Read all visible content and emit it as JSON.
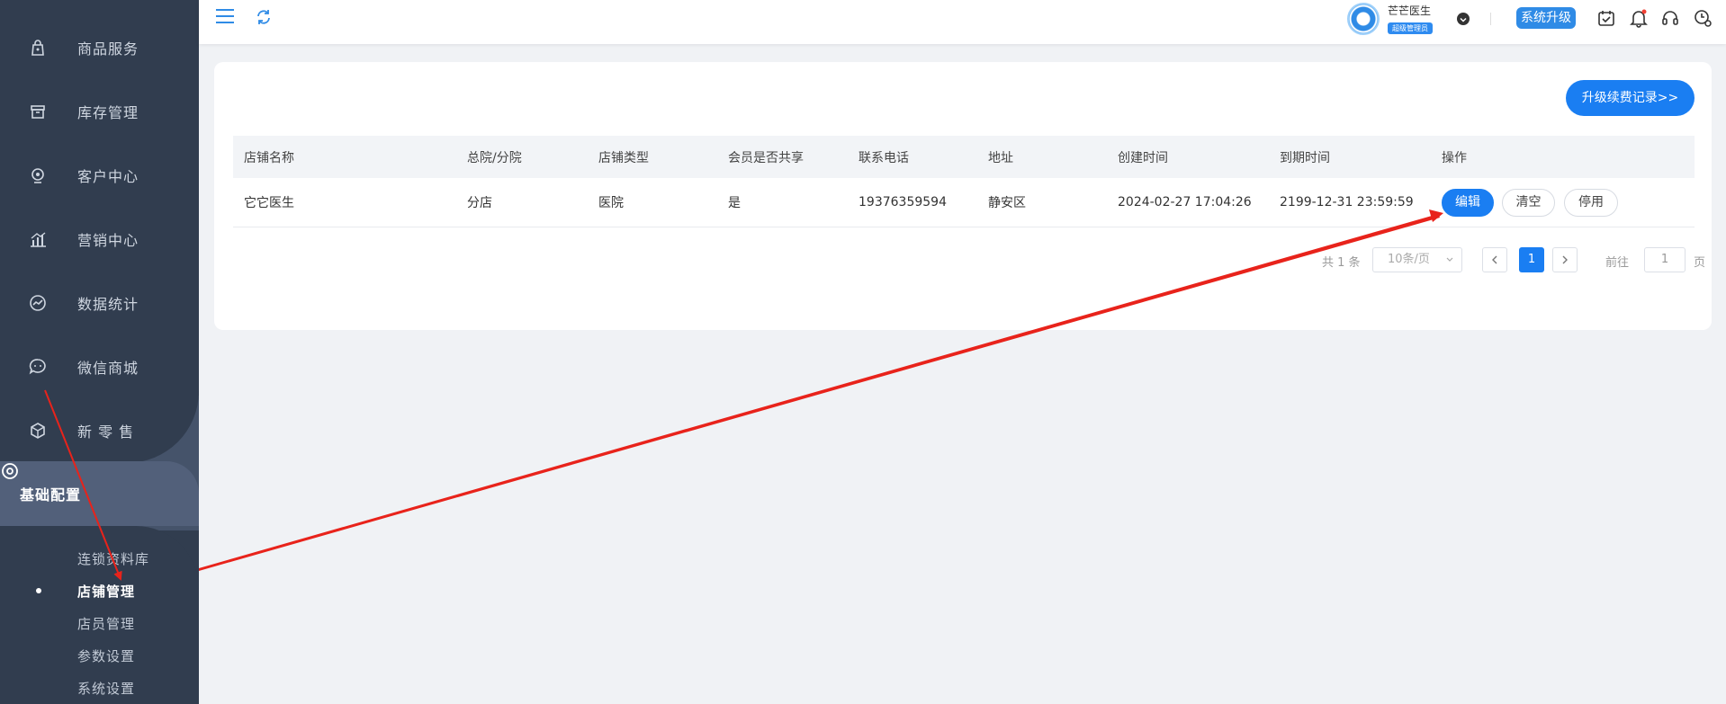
{
  "sidebar": {
    "items": [
      {
        "label": "商品服务",
        "icon": "bag-icon"
      },
      {
        "label": "库存管理",
        "icon": "box-icon"
      },
      {
        "label": "客户中心",
        "icon": "user-head-icon"
      },
      {
        "label": "营销中心",
        "icon": "bar-chart-icon"
      },
      {
        "label": "数据统计",
        "icon": "trend-icon"
      },
      {
        "label": "微信商城",
        "icon": "chat-icon"
      },
      {
        "label": "新 零 售",
        "icon": "cube-icon"
      },
      {
        "label": "基础配置",
        "icon": "settings-icon"
      }
    ],
    "subitems": [
      {
        "label": "连锁资料库"
      },
      {
        "label": "店铺管理"
      },
      {
        "label": "店员管理"
      },
      {
        "label": "参数设置"
      },
      {
        "label": "系统设置"
      }
    ]
  },
  "topbar": {
    "user_name": "芒芒医生",
    "user_role": "超级管理员",
    "upgrade_label": "系统升级"
  },
  "main": {
    "record_button": "升级续费记录>>",
    "table": {
      "headers": [
        "店铺名称",
        "总院/分院",
        "店铺类型",
        "会员是否共享",
        "联系电话",
        "地址",
        "创建时间",
        "到期时间",
        "操作"
      ],
      "rows": [
        {
          "cells": [
            "它它医生",
            "分店",
            "医院",
            "是",
            "19376359594",
            "静安区",
            "2024-02-27 17:04:26",
            "2199-12-31 23:59:59"
          ],
          "actions": [
            "编辑",
            "清空",
            "停用"
          ]
        }
      ]
    },
    "pagination": {
      "total": "共 1 条",
      "page_size": "10条/页",
      "current": "1",
      "goto_label": "前往",
      "goto_value": "1",
      "page_unit": "页"
    }
  },
  "colors": {
    "sidebar_bg": "#313d4f",
    "accent": "#1a7ef2",
    "annotation_arrow": "#e8231b"
  }
}
